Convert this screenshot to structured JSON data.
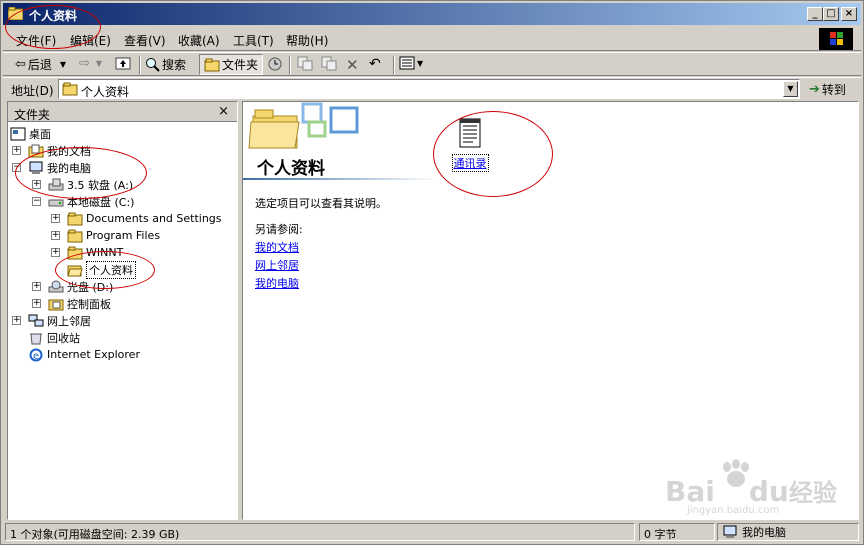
{
  "window": {
    "title": "个人资料",
    "controls": {
      "minimize": "_",
      "maximize": "□",
      "close": "×"
    }
  },
  "menu": [
    "文件(F)",
    "编辑(E)",
    "查看(V)",
    "收藏(A)",
    "工具(T)",
    "帮助(H)"
  ],
  "toolbar": {
    "back": "后退",
    "search": "搜索",
    "folders": "文件夹"
  },
  "address": {
    "label": "地址(D)",
    "value": "个人资料",
    "go": "转到"
  },
  "folder_pane": {
    "title": "文件夹",
    "close": "×",
    "tree": [
      {
        "label": "桌面"
      },
      {
        "label": "我的文档"
      },
      {
        "label": "我的电脑"
      },
      {
        "label": "3.5 软盘 (A:)"
      },
      {
        "label": "本地磁盘 (C:)"
      },
      {
        "label": "Documents and Settings"
      },
      {
        "label": "Program Files"
      },
      {
        "label": "WINNT"
      },
      {
        "label": "个人资料"
      },
      {
        "label": "光盘 (D:)"
      },
      {
        "label": "控制面板"
      },
      {
        "label": "网上邻居"
      },
      {
        "label": "回收站"
      },
      {
        "label": "Internet Explorer"
      }
    ]
  },
  "content": {
    "folder_title": "个人资料",
    "description": "选定项目可以查看其说明。",
    "see_also": "另请参阅:",
    "links": [
      "我的文档",
      "网上邻居",
      "我的电脑"
    ],
    "file": "通讯录"
  },
  "status": {
    "objects": "1 个对象(可用磁盘空间: 2.39 GB)",
    "size": "0 字节",
    "zone": "我的电脑"
  },
  "watermark": {
    "brand": "Bai",
    "suffix": "du",
    "cn": "经验",
    "url": "jingyan.baidu.com"
  },
  "colors": {
    "annotation": "#d00000",
    "titlebar_start": "#0a246a",
    "titlebar_end": "#a6caf0",
    "link": "#0000ee"
  }
}
